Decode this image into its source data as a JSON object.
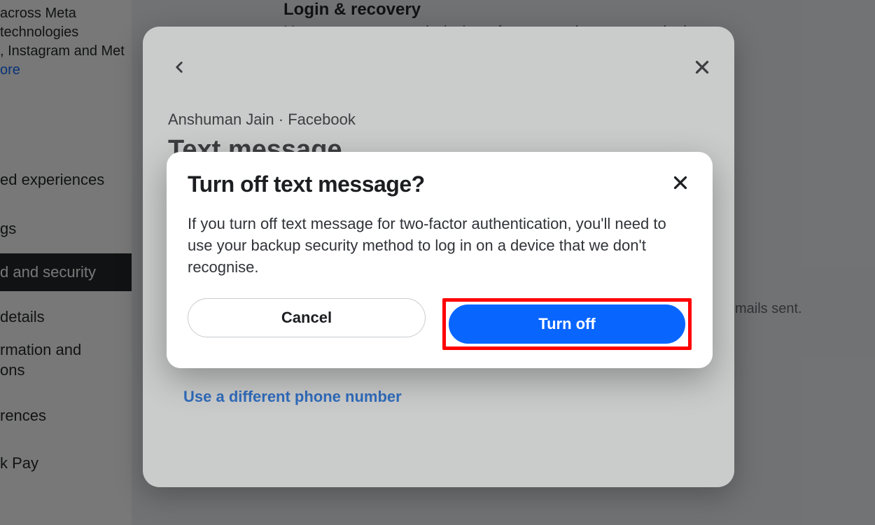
{
  "background": {
    "sidebar": {
      "desc_line1": "across Meta technologies",
      "desc_line2_pre": ", Instagram and Met",
      "learn_more": "ore",
      "items": [
        "ed experiences",
        "gs",
        "d and security",
        " details",
        "rmation and",
        "ons",
        "rences",
        "k Pay"
      ],
      "active_index": 2
    },
    "main": {
      "section_title": "Login & recovery",
      "section_sub": "Manage your passwords, login preferences and recovery methods.",
      "sub_line": "mails sent."
    }
  },
  "outer_modal": {
    "breadcrumb": "Anshuman Jain · Facebook",
    "title": "Text message",
    "use_different": "Use a different phone number"
  },
  "inner_modal": {
    "title": "Turn off text message?",
    "body": "If you turn off text message for two-factor authentication, you'll need to use your backup security method to log in on a device that we don't recognise.",
    "cancel": "Cancel",
    "confirm": "Turn off"
  }
}
